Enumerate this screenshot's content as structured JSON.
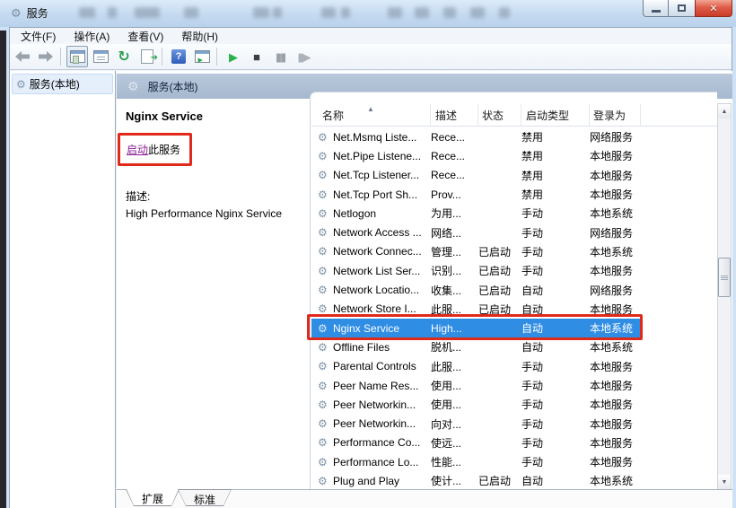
{
  "window": {
    "title": "服务",
    "icon": "gear-icon",
    "controls": [
      "minimize-icon",
      "maximize-icon",
      "close-icon"
    ]
  },
  "menu": {
    "items": [
      "文件(F)",
      "操作(A)",
      "查看(V)",
      "帮助(H)"
    ]
  },
  "toolbar": {
    "buttons": [
      "back-icon",
      "forward-icon",
      "console-tree-icon",
      "properties-icon",
      "refresh-icon",
      "export-list-icon",
      "help-icon",
      "show-hide-tree-icon",
      "start-service-icon",
      "stop-service-icon",
      "pause-service-icon",
      "restart-service-icon"
    ]
  },
  "sidebar": {
    "root_label": "服务(本地)"
  },
  "banner": {
    "title": "服务(本地)"
  },
  "detail_panel": {
    "service_name": "Nginx Service",
    "start_link": "启动",
    "start_link_suffix": "此服务",
    "description_label": "描述:",
    "description": "High Performance Nginx Service"
  },
  "service_list": {
    "columns": [
      "名称",
      "描述",
      "状态",
      "启动类型",
      "登录为"
    ],
    "sort_indicator": "ascending",
    "rows": [
      {
        "name": "Net.Msmq Liste...",
        "description": "Rece...",
        "status": "",
        "startup_type": "禁用",
        "logon_as": "网络服务",
        "selected": false
      },
      {
        "name": "Net.Pipe Listene...",
        "description": "Rece...",
        "status": "",
        "startup_type": "禁用",
        "logon_as": "本地服务",
        "selected": false
      },
      {
        "name": "Net.Tcp Listener...",
        "description": "Rece...",
        "status": "",
        "startup_type": "禁用",
        "logon_as": "本地服务",
        "selected": false
      },
      {
        "name": "Net.Tcp Port Sh...",
        "description": "Prov...",
        "status": "",
        "startup_type": "禁用",
        "logon_as": "本地服务",
        "selected": false
      },
      {
        "name": "Netlogon",
        "description": "为用...",
        "status": "",
        "startup_type": "手动",
        "logon_as": "本地系统",
        "selected": false
      },
      {
        "name": "Network Access ...",
        "description": "网络...",
        "status": "",
        "startup_type": "手动",
        "logon_as": "网络服务",
        "selected": false
      },
      {
        "name": "Network Connec...",
        "description": "管理...",
        "status": "已启动",
        "startup_type": "手动",
        "logon_as": "本地系统",
        "selected": false
      },
      {
        "name": "Network List Ser...",
        "description": "识别...",
        "status": "已启动",
        "startup_type": "手动",
        "logon_as": "本地服务",
        "selected": false
      },
      {
        "name": "Network Locatio...",
        "description": "收集...",
        "status": "已启动",
        "startup_type": "自动",
        "logon_as": "网络服务",
        "selected": false
      },
      {
        "name": "Network Store I...",
        "description": "此服...",
        "status": "已启动",
        "startup_type": "自动",
        "logon_as": "本地服务",
        "selected": false
      },
      {
        "name": "Nginx Service",
        "description": "High...",
        "status": "",
        "startup_type": "自动",
        "logon_as": "本地系统",
        "selected": true
      },
      {
        "name": "Offline Files",
        "description": "脱机...",
        "status": "",
        "startup_type": "自动",
        "logon_as": "本地系统",
        "selected": false
      },
      {
        "name": "Parental Controls",
        "description": "此服...",
        "status": "",
        "startup_type": "手动",
        "logon_as": "本地服务",
        "selected": false
      },
      {
        "name": "Peer Name Res...",
        "description": "使用...",
        "status": "",
        "startup_type": "手动",
        "logon_as": "本地服务",
        "selected": false
      },
      {
        "name": "Peer Networkin...",
        "description": "使用...",
        "status": "",
        "startup_type": "手动",
        "logon_as": "本地服务",
        "selected": false
      },
      {
        "name": "Peer Networkin...",
        "description": "向对...",
        "status": "",
        "startup_type": "手动",
        "logon_as": "本地服务",
        "selected": false
      },
      {
        "name": "Performance Co...",
        "description": "使远...",
        "status": "",
        "startup_type": "手动",
        "logon_as": "本地服务",
        "selected": false
      },
      {
        "name": "Performance Lo...",
        "description": "性能...",
        "status": "",
        "startup_type": "手动",
        "logon_as": "本地服务",
        "selected": false
      },
      {
        "name": "Plug and Play",
        "description": "使计...",
        "status": "已启动",
        "startup_type": "自动",
        "logon_as": "本地系统",
        "selected": false
      }
    ]
  },
  "tabs": {
    "items": [
      "扩展",
      "标准"
    ],
    "active": "扩展"
  },
  "colors": {
    "selection_blue": "#2f8de4",
    "annotation_red": "#e0291a",
    "visited_link_purple": "#8b2097",
    "titlebar_glass": "#c3d9ef",
    "banner_top": "#bac9dc",
    "banner_bottom": "#a6b8cf"
  }
}
